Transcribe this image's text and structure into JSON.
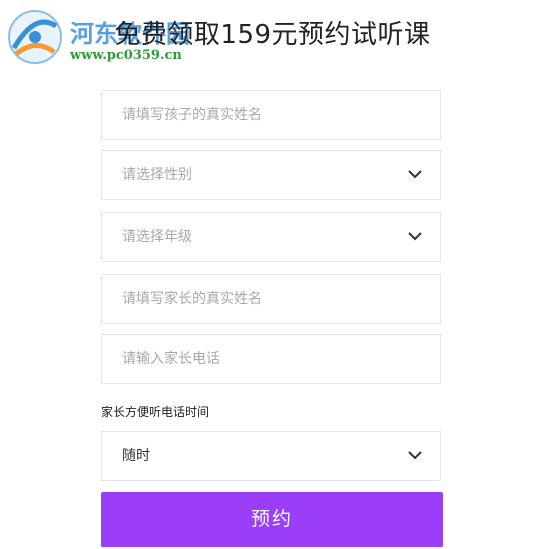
{
  "page": {
    "title": "免费领取159元预约试听课"
  },
  "watermark": {
    "site_name": "河东软件园",
    "url": "www.pc0359.cn"
  },
  "form": {
    "child_name": {
      "placeholder": "请填写孩子的真实姓名"
    },
    "gender": {
      "placeholder": "请选择性别"
    },
    "grade": {
      "placeholder": "请选择年级"
    },
    "parent_name": {
      "placeholder": "请填写家长的真实姓名"
    },
    "parent_phone": {
      "placeholder": "请输入家长电话"
    },
    "call_time": {
      "label": "家长方便听电话时间",
      "value": "随时"
    },
    "submit_label": "预约"
  },
  "colors": {
    "accent": "#9a3ef9",
    "border": "#e4e4e4",
    "placeholder": "#a9a9a9"
  },
  "icons": {
    "dropdown": "chevron-down-icon"
  }
}
